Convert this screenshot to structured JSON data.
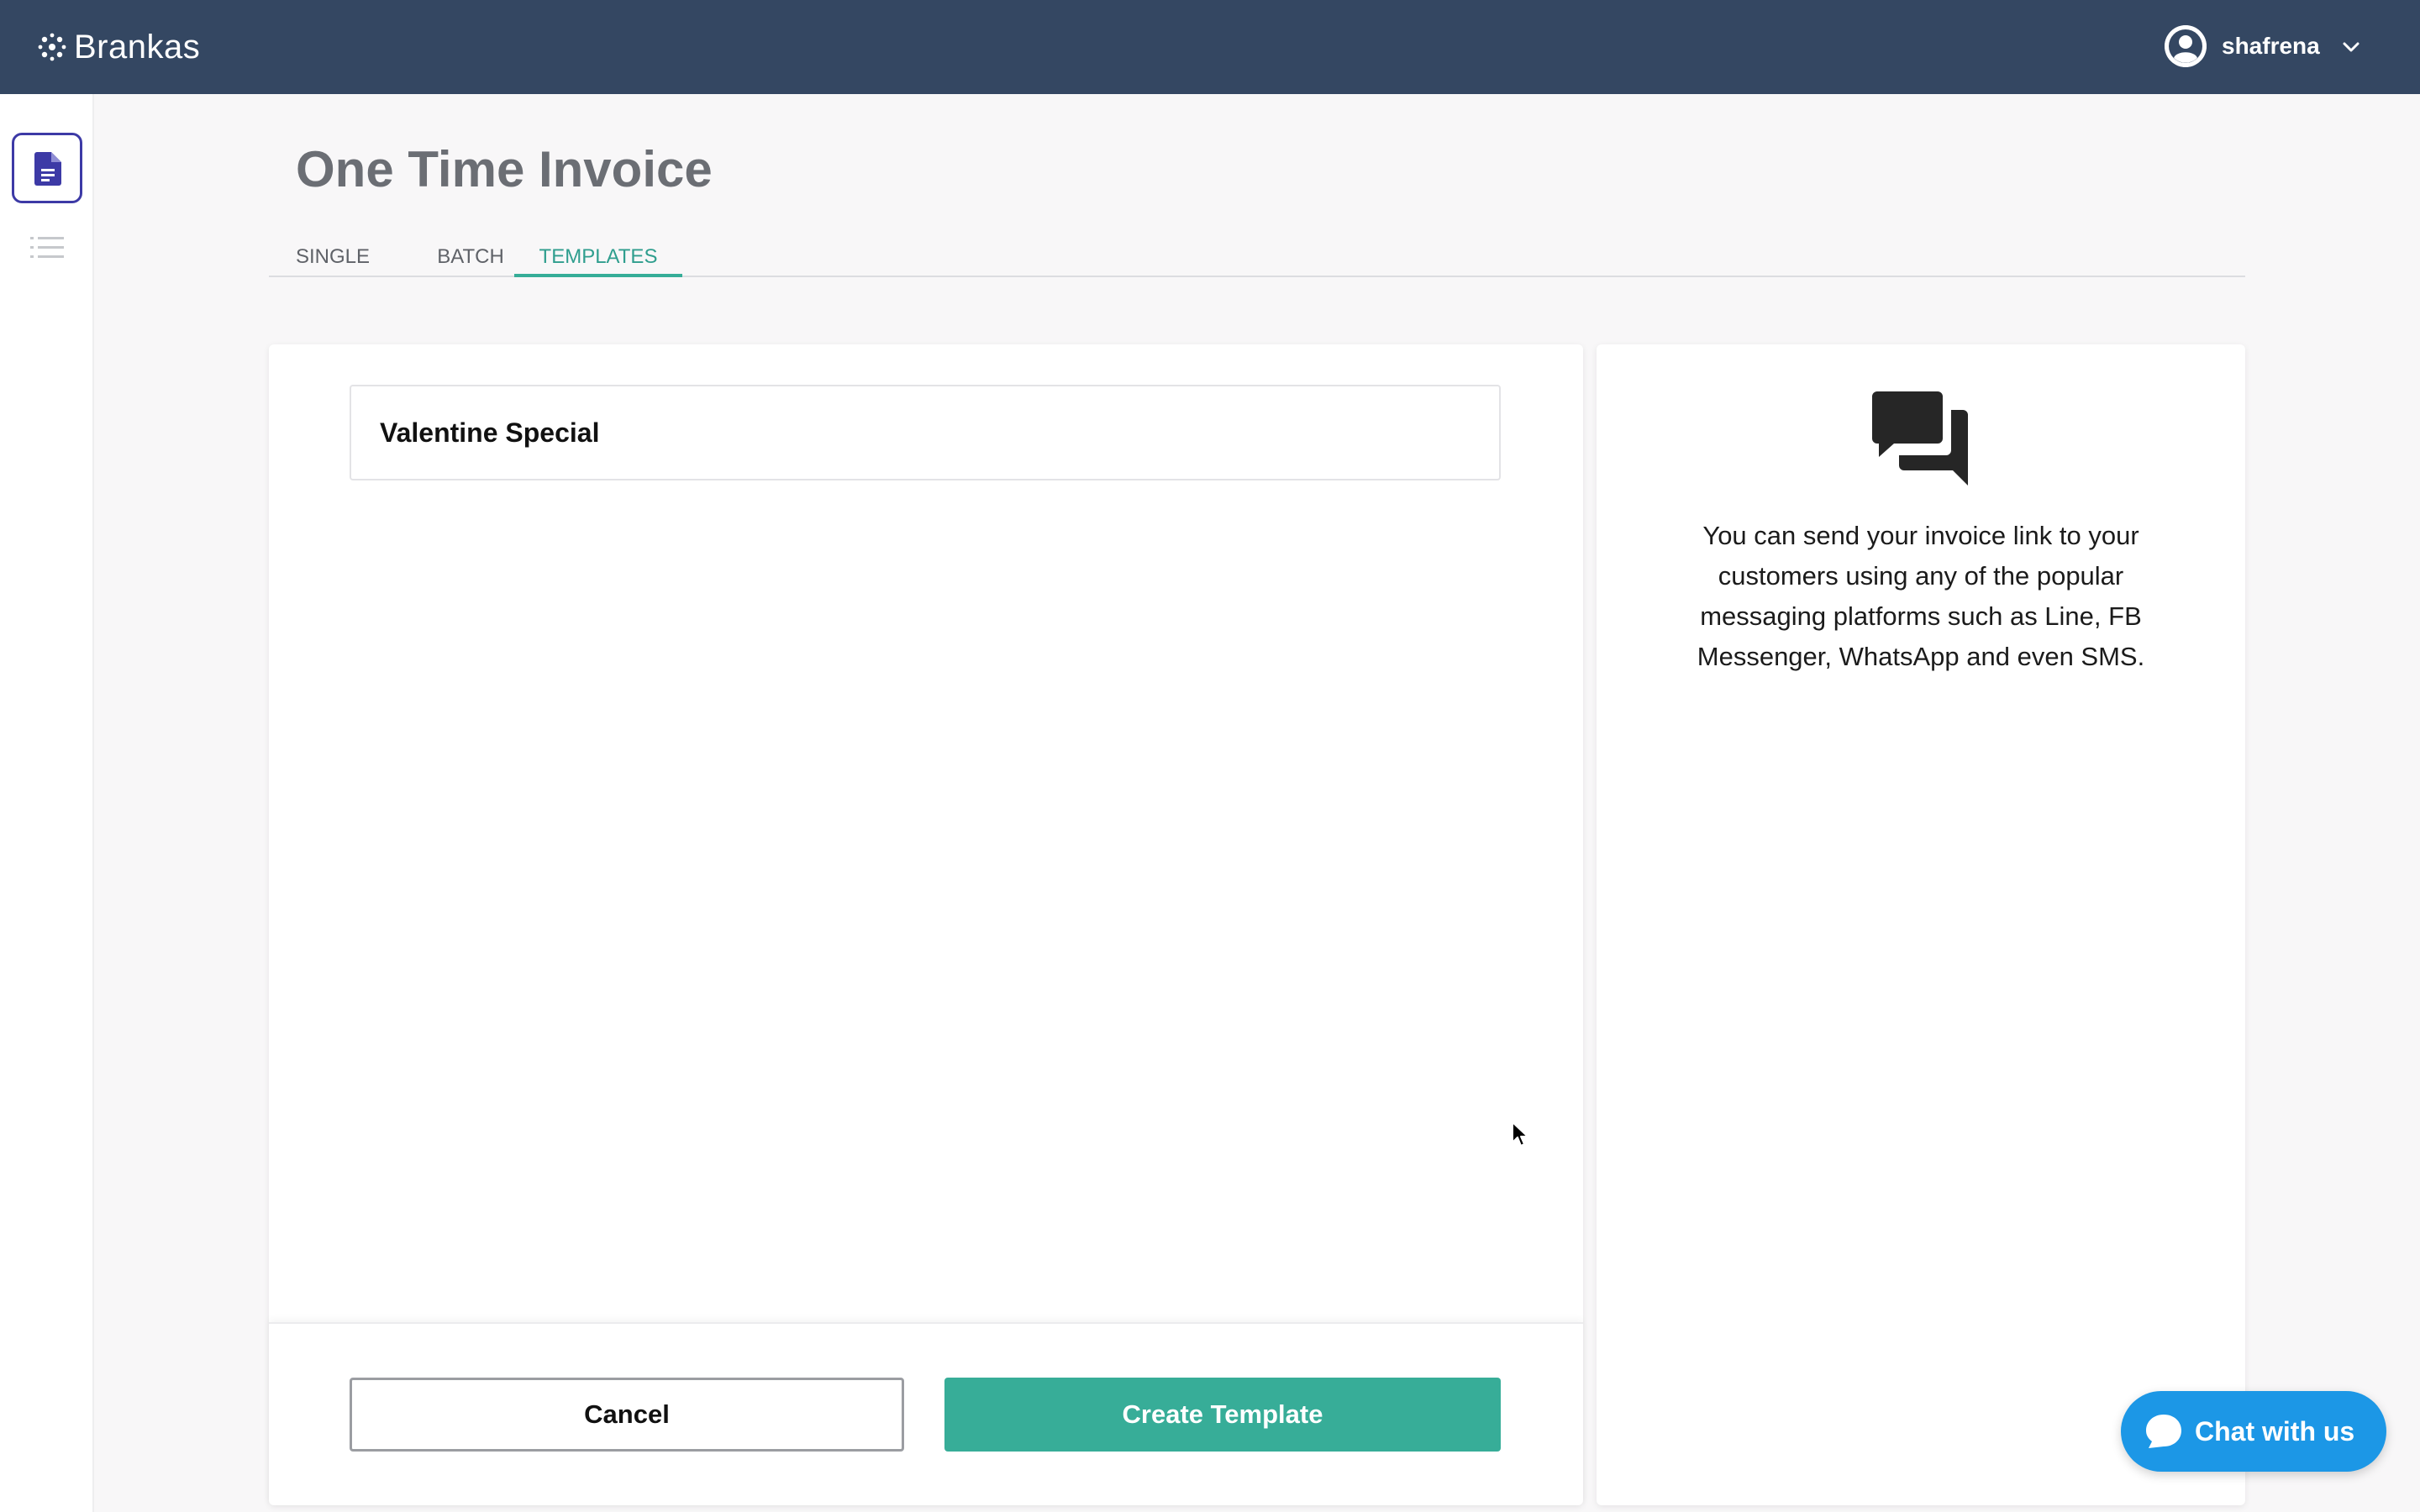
{
  "app": {
    "name": "Brankas"
  },
  "user": {
    "name": "shafrena"
  },
  "page": {
    "title": "One Time Invoice"
  },
  "tabs": [
    {
      "label": "SINGLE",
      "active": false
    },
    {
      "label": "BATCH",
      "active": false
    },
    {
      "label": "TEMPLATES",
      "active": true
    }
  ],
  "form": {
    "template_name": "Valentine Special",
    "cancel_label": "Cancel",
    "create_label": "Create Template"
  },
  "info": {
    "icon": "chat-bubbles-icon",
    "text": "You can send your invoice link to your customers using any of the popular messaging platforms such as Line, FB Messenger, WhatsApp and even SMS."
  },
  "chat_widget": {
    "label": "Chat with us"
  },
  "colors": {
    "topbar": "#344762",
    "accent": "#37ad98",
    "sidebar_active": "#3d3aa6",
    "chat_widget": "#1c97e6"
  }
}
